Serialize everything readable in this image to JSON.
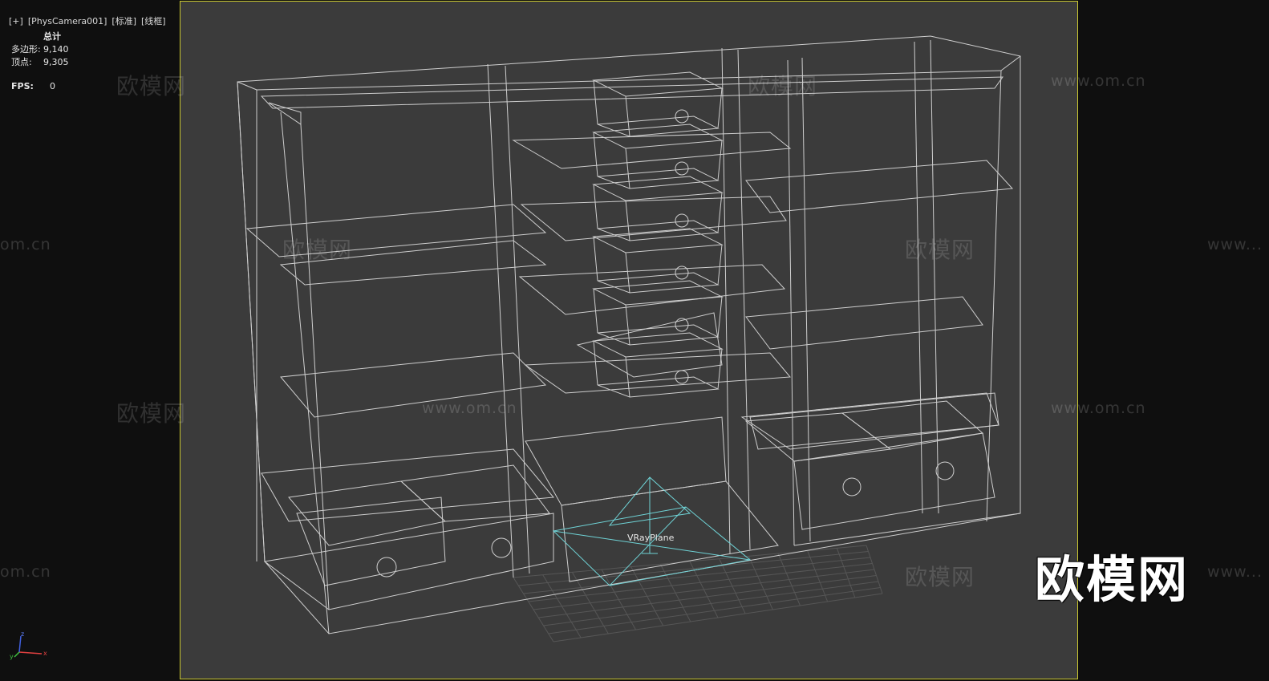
{
  "viewport": {
    "labels": [
      "[+]",
      "[PhysCamera001]",
      "[标准]",
      "[线框]"
    ]
  },
  "stats": {
    "title": "总计",
    "polygons_label": "多边形:",
    "polygons_value": "9,140",
    "vertices_label": "顶点:",
    "vertices_value": "9,305",
    "fps_label": "FPS:",
    "fps_value": "0"
  },
  "scene": {
    "object_label": "VRayPlane",
    "axis_labels": {
      "x": "x",
      "z": "z",
      "y": "y"
    }
  },
  "watermarks": {
    "brand": "欧模网",
    "url": "www.om.cn",
    "url_short": "om.cn",
    "url_partial": "www..."
  },
  "colors": {
    "viewport_bg": "#3b3b3b",
    "safe_frame": "#c9c630",
    "wire": "#e8e8e8",
    "vray_plane": "#6fd3d6",
    "grid": "#5a5a5a"
  }
}
